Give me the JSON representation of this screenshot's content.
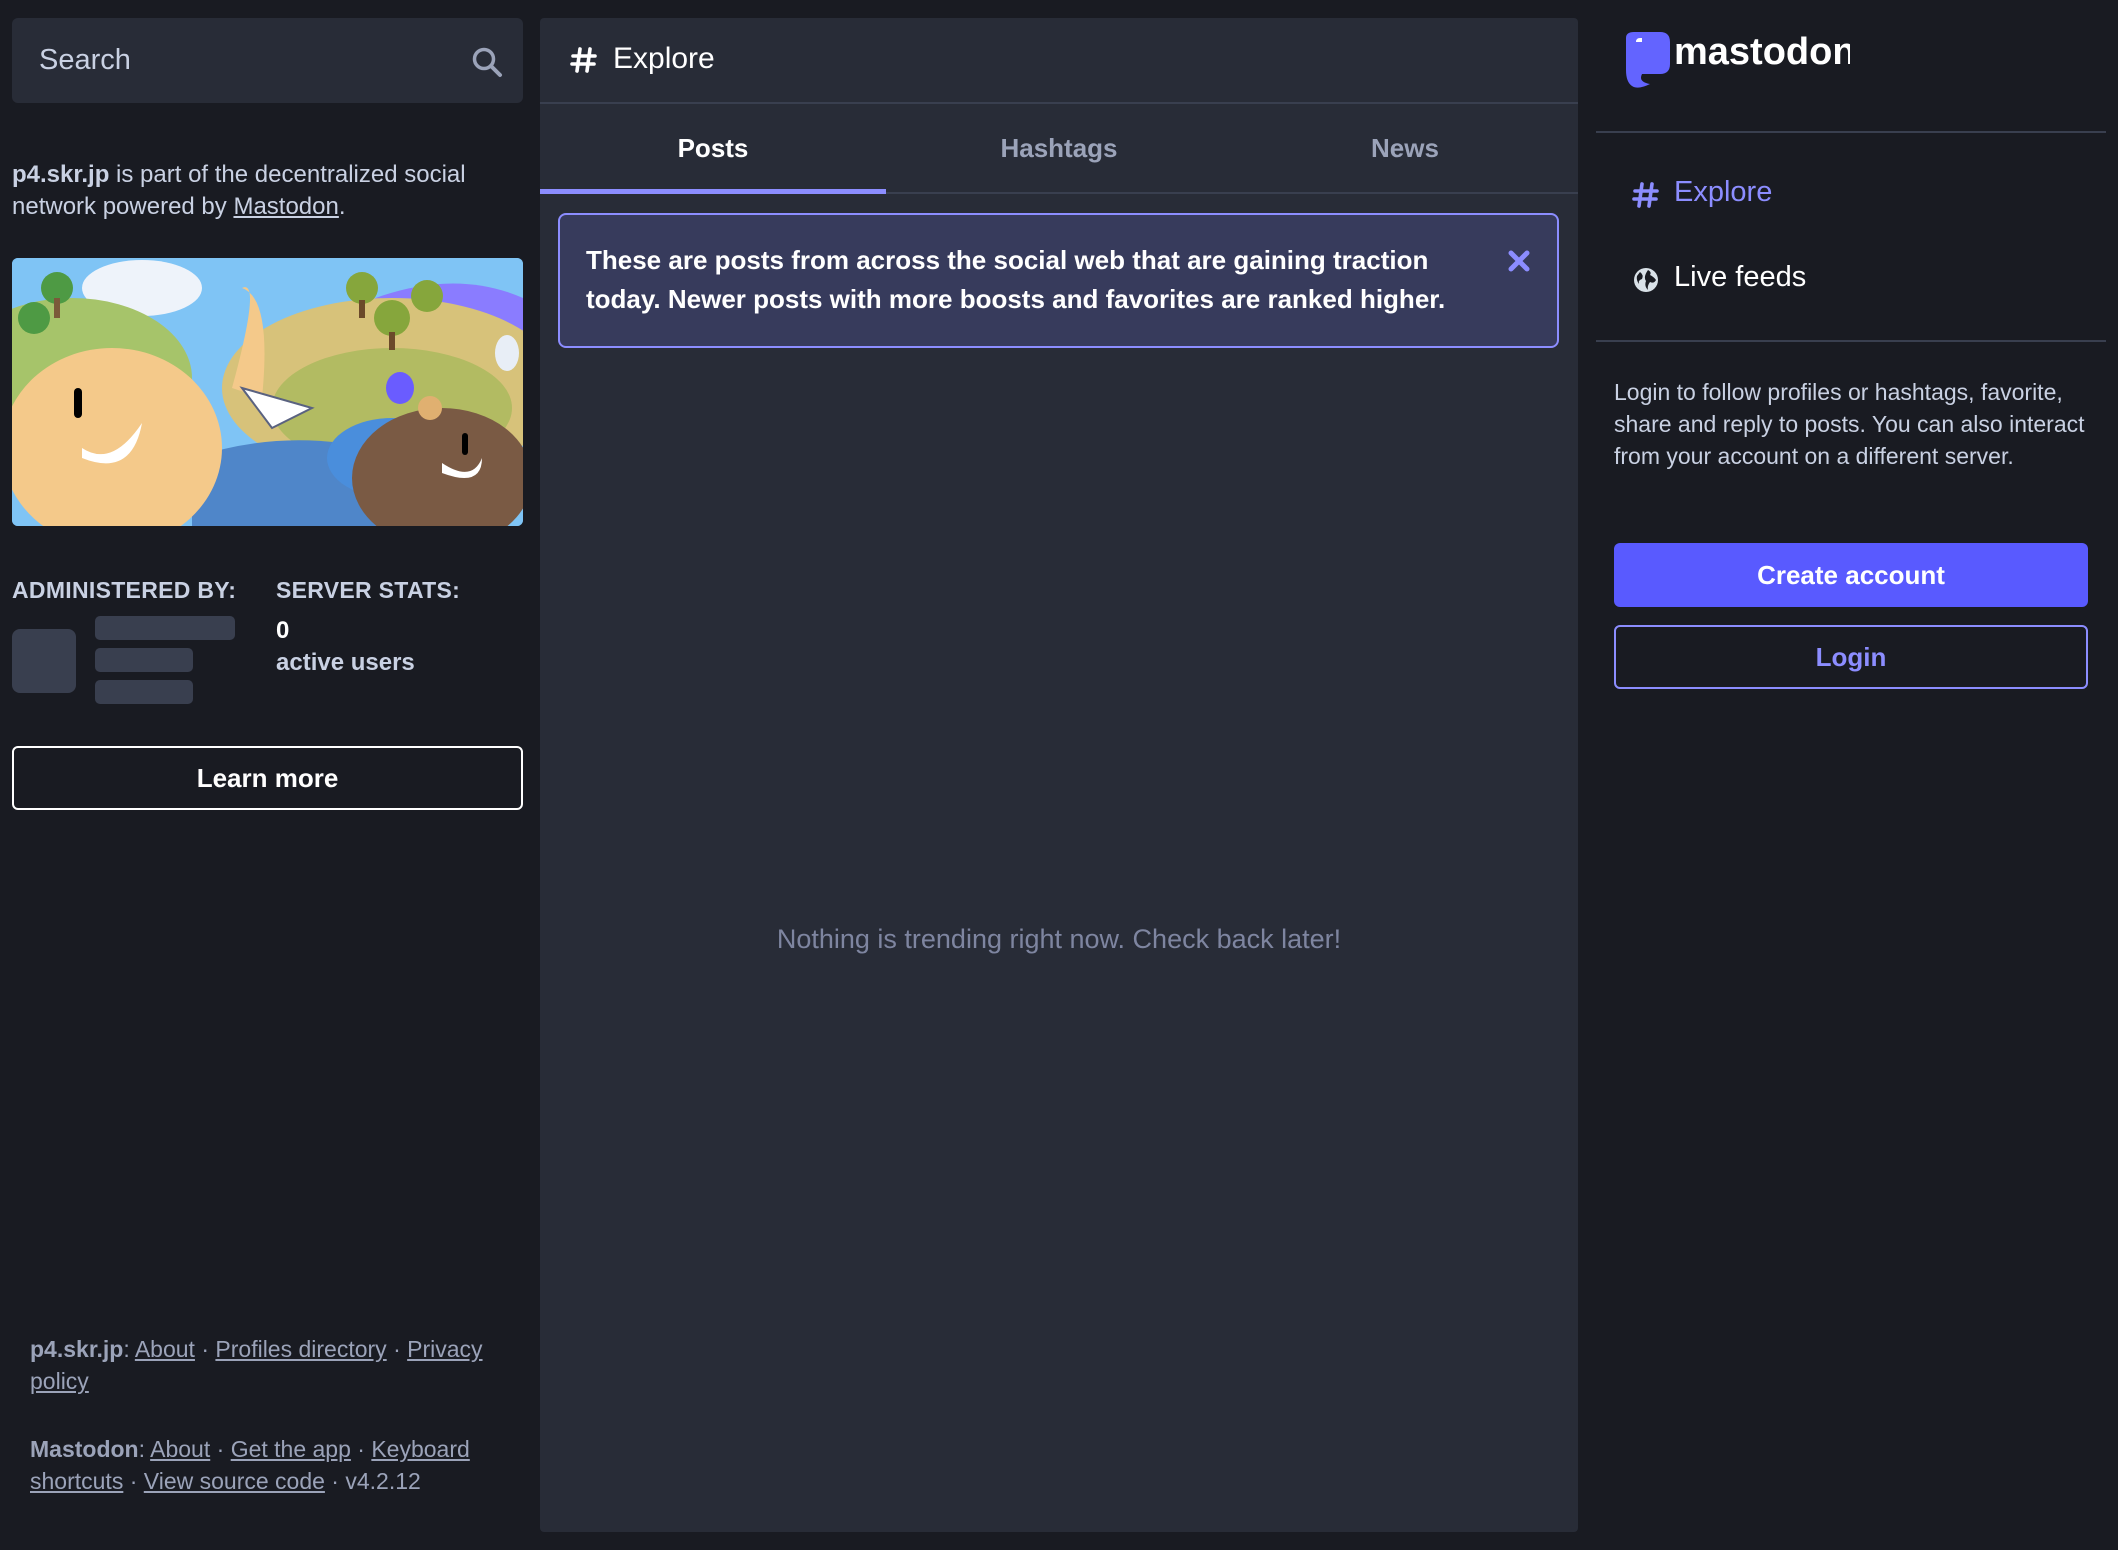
{
  "colors": {
    "background": "#191b22",
    "column": "#282c37",
    "accent": "#8c8dff",
    "primary_button": "#595aff",
    "muted_text": "#9ba3b9",
    "secondary_text": "#c9d1e3"
  },
  "search": {
    "placeholder": "Search",
    "icon": "search-icon"
  },
  "server_intro": {
    "domain": "p4.skr.jp",
    "text_middle": " is part of the decentralized social network powered by ",
    "link": "Mastodon",
    "text_end": "."
  },
  "hero_image": {
    "description_icon": "mastodon-hero-illustration"
  },
  "admin": {
    "label": "ADMINISTERED BY:"
  },
  "stats": {
    "label": "SERVER STATS:",
    "active_users_count": "0",
    "active_users_label": "active users"
  },
  "learn_more_label": "Learn more",
  "footer": {
    "server": {
      "domain": "p4.skr.jp",
      "sep": ": ",
      "links": [
        "About",
        "Profiles directory",
        "Privacy policy"
      ],
      "dot": " · "
    },
    "mastodon": {
      "name": "Mastodon",
      "sep": ": ",
      "links": [
        "About",
        "Get the app",
        "Keyboard shortcuts",
        "View source code"
      ],
      "version": "v4.2.12",
      "dot": " · "
    }
  },
  "column": {
    "title": "Explore",
    "icon": "hashtag-icon",
    "tabs": [
      {
        "label": "Posts",
        "active": true
      },
      {
        "label": "Hashtags",
        "active": false
      },
      {
        "label": "News",
        "active": false
      }
    ],
    "banner_text": "These are posts from across the social web that are gaining traction today. Newer posts with more boosts and favorites are ranked higher.",
    "empty_message": "Nothing is trending right now. Check back later!"
  },
  "sidebar": {
    "logo_text": "mastodon",
    "nav": [
      {
        "label": "Explore",
        "icon": "hashtag-icon",
        "active": true
      },
      {
        "label": "Live feeds",
        "icon": "globe-icon",
        "active": false
      }
    ],
    "login_info": "Login to follow profiles or hashtags, favorite, share and reply to posts. You can also interact from your account on a different server.",
    "create_account_label": "Create account",
    "login_label": "Login"
  }
}
